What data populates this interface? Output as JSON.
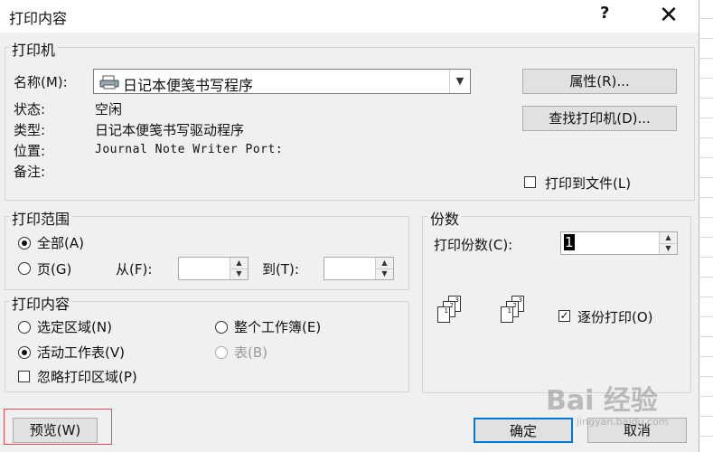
{
  "window": {
    "title": "打印内容",
    "help": "?",
    "close": "✕"
  },
  "printer": {
    "group_label": "打印机",
    "name_label": "名称(M):",
    "name_value": "日记本便笺书写程序",
    "status_label": "状态:",
    "status_value": "空闲",
    "type_label": "类型:",
    "type_value": "日记本便笺书写驱动程序",
    "location_label": "位置:",
    "location_value": "Journal Note Writer Port:",
    "comment_label": "备注:",
    "properties_button": "属性(R)...",
    "find_printer_button": "查找打印机(D)...",
    "print_to_file_label": "打印到文件(L)",
    "print_to_file_checked": false
  },
  "print_range": {
    "group_label": "打印范围",
    "all_label": "全部(A)",
    "all_selected": true,
    "pages_label": "页(G)",
    "from_label": "从(F):",
    "from_value": "",
    "to_label": "到(T):",
    "to_value": ""
  },
  "copies": {
    "group_label": "份数",
    "count_label": "打印份数(C):",
    "count_value": "1",
    "collate_label": "逐份打印(O)",
    "collate_checked": true
  },
  "print_what": {
    "group_label": "打印内容",
    "selection_label": "选定区域(N)",
    "entire_workbook_label": "整个工作簿(E)",
    "active_sheets_label": "活动工作表(V)",
    "active_sheets_selected": true,
    "table_label": "表(B)",
    "ignore_print_areas_label": "忽略打印区域(P)",
    "ignore_print_areas_checked": false
  },
  "buttons": {
    "preview": "预览(W)",
    "ok": "确定",
    "cancel": "取消"
  },
  "watermark": {
    "brand": "Bai 经验",
    "url": "jingyan.baidu.com"
  }
}
